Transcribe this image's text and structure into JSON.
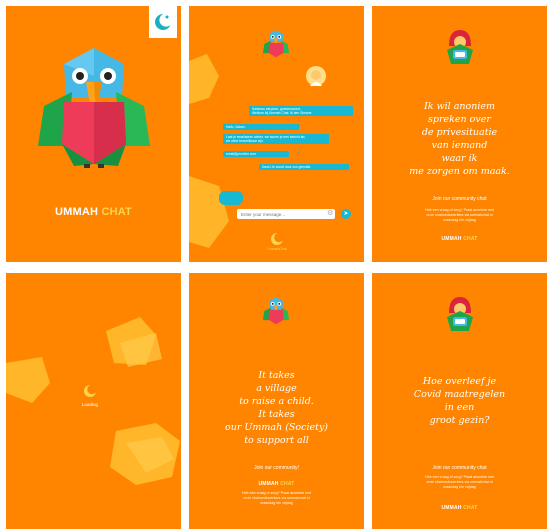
{
  "panels": {
    "splash": {
      "logo_name": "Ummah Chat crescent logo",
      "brand_a": "UMMAH",
      "brand_b": "CHAT"
    },
    "chat": {
      "messages": [
        {
          "text": "Salamou aleykom, goedenavond.\nWelkom bij Ummah Chat. Ik ben Simone."
        },
        {
          "text": "Hallo, Salam."
        },
        {
          "text": "Laat je emailadres achter, we sturen je een bericht als\nwe weer beschikbaar zijn."
        },
        {
          "text": "email@provider.com"
        },
        {
          "text": "Dank! Je wordt door ons gemaild."
        }
      ],
      "input_placeholder": "Enter your message...",
      "footer_brand": "UmmahChat"
    },
    "quote_privacy": {
      "quote": "Ik wil anoniem\nspreken over\nde privesituatie\nvan iemand\nwaar ik\nme zorgen om maak.",
      "join_a": "Join",
      "join_b": "our community chat",
      "small": "Heb een vraag of zorg? Praat anoniem met\nonze chatmedewerkers via ummahchat.nl\nmaandag t/m vrijdag",
      "brand_a": "UMMAH",
      "brand_b": "CHAT"
    },
    "loading": {
      "label": "Loading"
    },
    "quote_village": {
      "quote": "It takes\na village\nto raise a child.\nIt takes\nour Ummah (Society)\nto support all",
      "join_a": "Join",
      "join_b": "our community!",
      "small": "Heb een vraag of zorg? Praat anoniem met\nonze chatmedewerkers via ummahchat.nl\nmaandag t/m vrijdag",
      "brand_a": "UMMAH",
      "brand_b": "CHAT"
    },
    "quote_covid": {
      "quote": "Hoe overleef je\nCovid maatregelen\nin een\ngroot gezin?",
      "join_a": "Join",
      "join_b": "our community chat",
      "small": "Heb een vraag of zorg? Praat anoniem met\nonze chatmedewerkers via ummahchat.nl\nmaandag t/m vrijdag",
      "brand_a": "UMMAH",
      "brand_b": "CHAT"
    }
  },
  "colors": {
    "background": "#ff8500",
    "accent": "#19b8d2",
    "parrot_blue": "#45b8e6",
    "parrot_green": "#1fa44a",
    "parrot_red": "#ee3b5a",
    "parrot_beak": "#ffa11a",
    "shape_yellow": "#ffbd2e",
    "brand_yellow": "#ffd34d"
  },
  "icons": [
    "parrot-mascot",
    "crescent-logo",
    "avatar-hijab-icon",
    "chat-bubbles-icon",
    "send-icon",
    "gear-icon",
    "check-icon"
  ]
}
